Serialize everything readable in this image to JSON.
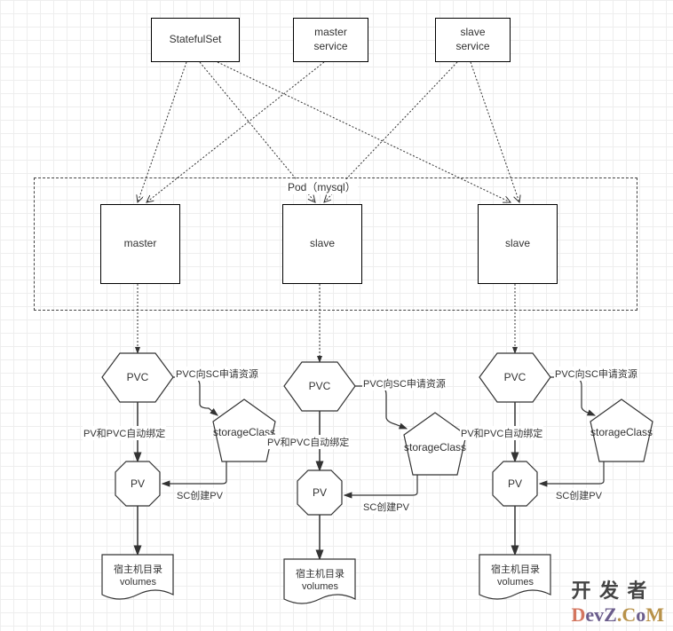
{
  "diagram": {
    "top_nodes": {
      "statefulset": "StatefulSet",
      "master_service": "master\nservice",
      "slave_service": "slave\nservice"
    },
    "container_label": "Pod（mysql）",
    "pods": {
      "master": "master",
      "slave1": "slave",
      "slave2": "slave"
    },
    "storage_labels": {
      "pvc": "PVC",
      "pv": "PV",
      "storage_class": "storageClass",
      "host_volumes": "宿主机目录\nvolumes"
    },
    "edge_labels": {
      "pvc_to_sc": "PVC向SC申请资源",
      "pv_pvc_bind": "PV和PVC自动绑定",
      "sc_create_pv": "SC创建PV"
    }
  },
  "watermark": {
    "line1": "开 发 者",
    "line2_parts": [
      "D",
      "evZ",
      ".C",
      "o",
      "M"
    ]
  }
}
